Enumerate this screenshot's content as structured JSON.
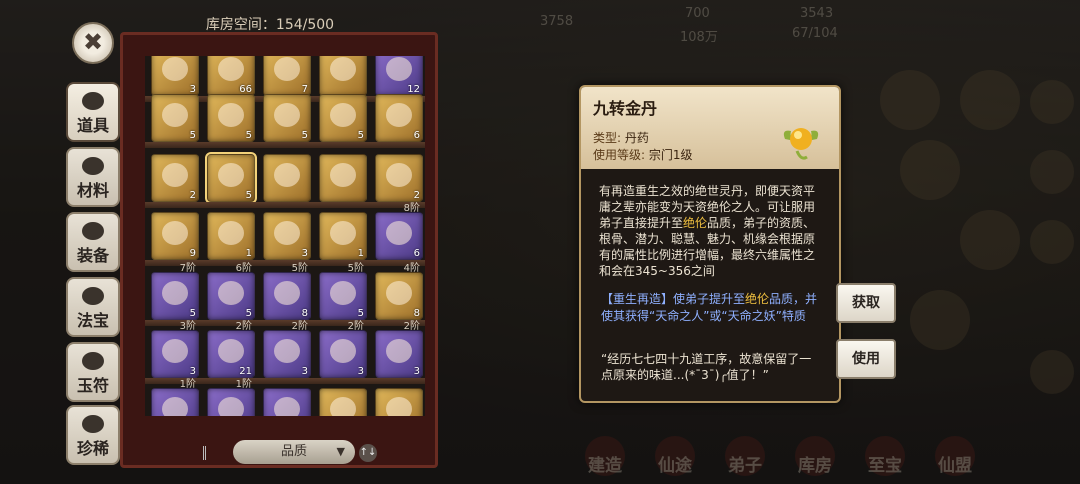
{
  "resources": {
    "val1": "700",
    "val2": "3543",
    "val3": "108万",
    "val4": "67/104",
    "val5": "3758"
  },
  "bottom_nav": [
    "建造",
    "仙途",
    "弟子",
    "库房",
    "至宝",
    "仙盟"
  ],
  "close_label": "✖",
  "tabs": [
    {
      "label": "道具",
      "icon": "bag-icon"
    },
    {
      "label": "材料",
      "icon": "herb-icon"
    },
    {
      "label": "装备",
      "icon": "armor-icon"
    },
    {
      "label": "法宝",
      "icon": "treasure-icon"
    },
    {
      "label": "玉符",
      "icon": "jade-icon"
    },
    {
      "label": "珍稀",
      "icon": "chest-icon"
    }
  ],
  "storage": {
    "title": "库房空间：154/500"
  },
  "rows": [
    {
      "items": [
        {
          "c": "gold",
          "n": "3"
        },
        {
          "c": "gold",
          "n": "66"
        },
        {
          "c": "gold",
          "n": "7"
        },
        {
          "c": "gold",
          "n": ""
        },
        {
          "c": "purple",
          "n": "12"
        }
      ]
    },
    {
      "items": [
        {
          "c": "gold",
          "n": "5"
        },
        {
          "c": "gold",
          "n": "5"
        },
        {
          "c": "gold",
          "n": "5"
        },
        {
          "c": "gold",
          "n": "5"
        },
        {
          "c": "gold",
          "n": "6"
        }
      ]
    },
    {
      "items": [
        {
          "c": "gold",
          "n": "2"
        },
        {
          "c": "gold",
          "n": "5",
          "sel": true
        },
        {
          "c": "gold",
          "n": ""
        },
        {
          "c": "gold",
          "n": ""
        },
        {
          "c": "gold",
          "n": "2"
        }
      ]
    },
    {
      "items": [
        {
          "c": "gold",
          "n": "9"
        },
        {
          "c": "gold",
          "n": "1"
        },
        {
          "c": "gold",
          "n": "3"
        },
        {
          "c": "gold",
          "n": "1"
        },
        {
          "c": "purple",
          "n": "6",
          "t": "8阶"
        }
      ]
    },
    {
      "items": [
        {
          "c": "purple",
          "n": "5",
          "t": "7阶"
        },
        {
          "c": "purple",
          "n": "5",
          "t": "6阶"
        },
        {
          "c": "purple",
          "n": "8",
          "t": "5阶"
        },
        {
          "c": "purple",
          "n": "5",
          "t": "5阶"
        },
        {
          "c": "gold",
          "n": "8",
          "t": "4阶"
        }
      ]
    },
    {
      "items": [
        {
          "c": "purple",
          "n": "3",
          "t": "3阶"
        },
        {
          "c": "purple",
          "n": "21",
          "t": "2阶"
        },
        {
          "c": "purple",
          "n": "3",
          "t": "2阶"
        },
        {
          "c": "purple",
          "n": "3",
          "t": "2阶"
        },
        {
          "c": "purple",
          "n": "3",
          "t": "2阶"
        }
      ]
    },
    {
      "items": [
        {
          "c": "purple",
          "n": "",
          "t": "1阶"
        },
        {
          "c": "purple",
          "n": "",
          "t": "1阶"
        },
        {
          "c": "purple",
          "n": "",
          "t": ""
        },
        {
          "c": "gold",
          "n": "",
          "t": ""
        },
        {
          "c": "gold",
          "n": "",
          "t": ""
        }
      ]
    }
  ],
  "filter": {
    "label": "品质",
    "chevron": "▼",
    "order": "↑↓"
  },
  "tooltip": {
    "name": "九转金丹",
    "type_label": "类型:",
    "type_value": "丹药",
    "level_label": "使用等级:",
    "level_value": "宗门1级",
    "desc_a": "有再造重生之效的绝世灵丹，即便天资平庸之辈亦能变为天资绝伦之人。可让服用弟子直接提升至",
    "desc_hl": "绝伦",
    "desc_b": "品质，弟子的资质、根骨、潜力、聪慧、魅力、机缘会根据原有的属性比例进行增幅，最终六维属性之和会在345~356之间",
    "effect_a": "【重生再造】使弟子提升至",
    "effect_hl": "绝伦",
    "effect_b": "品质，并使其获得“天命之人”或“天命之妖”特质",
    "flavor": "“经历七七四十九道工序，故意保留了一点原来的味道...(*ˉ3ˉ)╭值了！”"
  },
  "actions": {
    "obtain": "获取",
    "use": "使用"
  }
}
